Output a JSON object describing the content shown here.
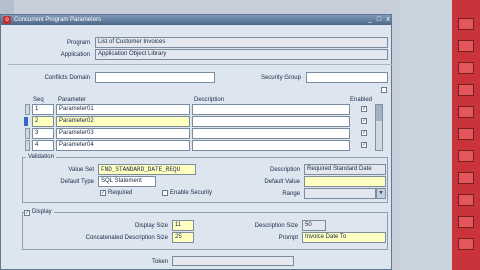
{
  "window": {
    "title": "Concurrent Program Parameters",
    "controls": [
      "_",
      "□",
      "x"
    ]
  },
  "header": {
    "program_label": "Program",
    "program_value": "List of Customer Invoices",
    "application_label": "Application",
    "application_value": "Application Object Library"
  },
  "row2": {
    "conflicts_label": "Conflicts Domain",
    "conflicts_value": "",
    "security_label": "Security Group",
    "security_value": ""
  },
  "params": {
    "col_seq": "Seq",
    "col_param": "Parameter",
    "col_desc": "Description",
    "col_enabled": "Enabled",
    "rows": [
      {
        "seq": "1",
        "name": "Parameter01",
        "desc": "",
        "enabled": true
      },
      {
        "seq": "2",
        "name": "Parameter02",
        "desc": "",
        "enabled": true
      },
      {
        "seq": "3",
        "name": "Parameter03",
        "desc": "",
        "enabled": true
      },
      {
        "seq": "4",
        "name": "Parameter04",
        "desc": "",
        "enabled": true
      }
    ]
  },
  "validation": {
    "group_label": "Validation",
    "value_set_label": "Value Set",
    "value_set_value": "FND_STANDARD_DATE_REQU",
    "description_label": "Description",
    "description_value": "Required Standard Date",
    "default_type_label": "Default Type",
    "default_type_value": "SQL Statement",
    "default_value_label": "Default Value",
    "default_value_value": "",
    "required_label": "Required",
    "required_checked": true,
    "enable_security_label": "Enable Security",
    "enable_security_checked": false,
    "range_label": "Range",
    "range_value": ""
  },
  "display": {
    "group_label": "Display",
    "checked": true,
    "display_size_label": "Display Size",
    "display_size_value": "11",
    "desc_size_label": "Description Size",
    "desc_size_value": "50",
    "concat_label": "Concatenated Description Size",
    "concat_value": "25",
    "prompt_label": "Prompt",
    "prompt_value": "Invoice Date To"
  },
  "footer": {
    "token_label": "Token",
    "token_value": ""
  }
}
